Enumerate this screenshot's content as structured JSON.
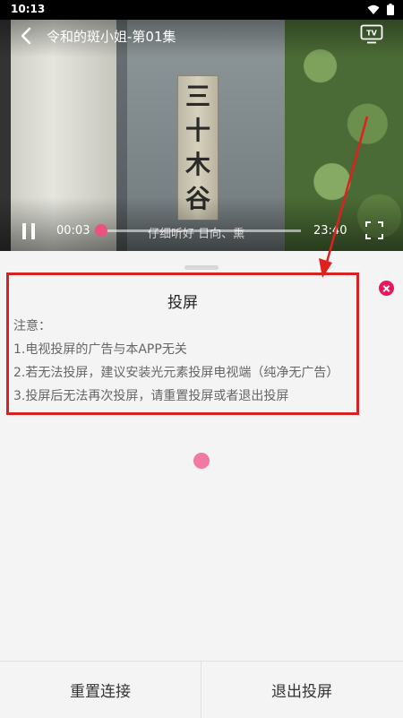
{
  "status_bar": {
    "time": "10:13"
  },
  "player": {
    "title": "令和的斑小姐-第01集",
    "current_time": "00:03",
    "total_time": "23:40",
    "subtitle": "仔细听好 日向、熏",
    "progress_fraction": 0.002,
    "sign_chars": [
      "三",
      "十",
      "木",
      "谷"
    ],
    "tv_label": "TV"
  },
  "cast_panel": {
    "title": "投屏",
    "notes": [
      "注意：",
      "1.电视投屏的广告与本APP无关",
      "2.若无法投屏，建议安装光元素投屏电视端（纯净无广告）",
      "3.投屏后无法再次投屏，请重置投屏或者退出投屏"
    ]
  },
  "bottom_bar": {
    "reset_label": "重置连接",
    "exit_label": "退出投屏"
  },
  "colors": {
    "accent": "#e8185c",
    "highlight_box": "#d42323",
    "loading_dot": "#f07aa3"
  }
}
